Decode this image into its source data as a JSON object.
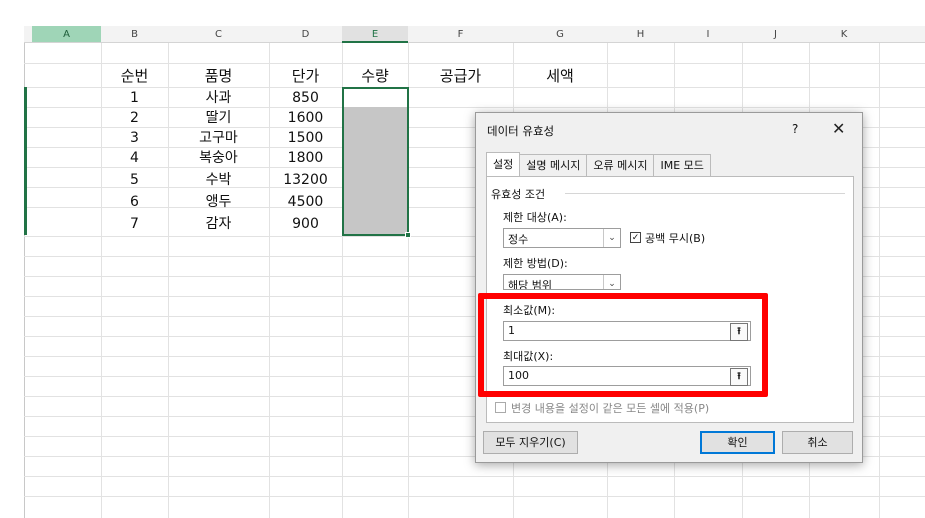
{
  "columns": [
    "A",
    "B",
    "C",
    "D",
    "E",
    "F",
    "G",
    "H",
    "I",
    "J",
    "K"
  ],
  "table": {
    "headers": [
      "순번",
      "품명",
      "단가",
      "수량",
      "공급가",
      "세액"
    ],
    "rows": [
      [
        "1",
        "사과",
        "850"
      ],
      [
        "2",
        "딸기",
        "1600"
      ],
      [
        "3",
        "고구마",
        "1500"
      ],
      [
        "4",
        "복숭아",
        "1800"
      ],
      [
        "5",
        "수박",
        "13200"
      ],
      [
        "6",
        "앵두",
        "4500"
      ],
      [
        "7",
        "감자",
        "900"
      ]
    ]
  },
  "dialog": {
    "title": "데이터 유효성",
    "help": "?",
    "close": "✕",
    "tabs": [
      "설정",
      "설명 메시지",
      "오류 메시지",
      "IME 모드"
    ],
    "group_title": "유효성 조건",
    "allow_label": "제한 대상(A):",
    "allow_value": "정수",
    "ignore_blank_label": "공백 무시(B)",
    "ignore_blank_checked": true,
    "data_label": "제한 방법(D):",
    "data_value": "해당 범위",
    "min_label": "최소값(M):",
    "min_value": "1",
    "max_label": "최대값(X):",
    "max_value": "100",
    "apply_label": "변경 내용을 설정이 같은 모든 셀에 적용(P)",
    "clear_all": "모두 지우기(C)",
    "ok": "확인",
    "cancel": "취소"
  },
  "colors": {
    "highlight": "#ff0000",
    "selection": "#217346",
    "selection_header": "#9fd5b7"
  }
}
